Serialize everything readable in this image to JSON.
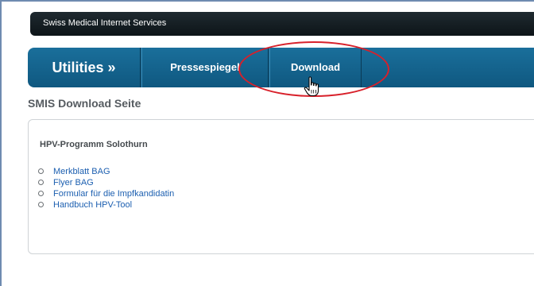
{
  "header": {
    "site_title": "Swiss Medical Internet Services"
  },
  "nav": {
    "section_title": "Utilities »",
    "items": [
      {
        "label": "Pressespiegel"
      },
      {
        "label": "Download"
      }
    ]
  },
  "page": {
    "heading": "SMIS Download Seite",
    "section_title": "HPV-Programm Solothurn",
    "links": [
      {
        "label": "Merkblatt BAG"
      },
      {
        "label": "Flyer BAG"
      },
      {
        "label": "Formular für die Impfkandidatin"
      },
      {
        "label": "Handbuch HPV-Tool"
      }
    ]
  },
  "annotations": {
    "highlight_color": "#d8202a",
    "cursor_icon": "hand-pointer-icon"
  }
}
